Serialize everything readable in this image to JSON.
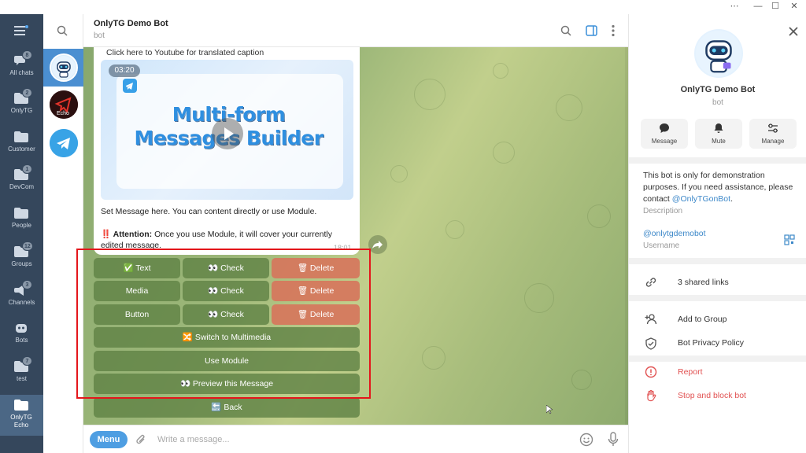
{
  "window": {
    "controls": [
      "⋯",
      "—",
      "☐",
      "✕"
    ]
  },
  "folders": [
    {
      "label": "All chats",
      "badge": "8",
      "icon": "chats-icon"
    },
    {
      "label": "OnlyTG",
      "badge": "2",
      "icon": "folder-icon"
    },
    {
      "label": "Customer",
      "badge": "",
      "icon": "folder-icon"
    },
    {
      "label": "DevCom",
      "badge": "1",
      "icon": "folder-icon"
    },
    {
      "label": "People",
      "badge": "",
      "icon": "folder-icon"
    },
    {
      "label": "Groups",
      "badge": "12",
      "icon": "groups-icon"
    },
    {
      "label": "Channels",
      "badge": "3",
      "icon": "channels-icon"
    },
    {
      "label": "Bots",
      "badge": "",
      "icon": "bots-icon"
    },
    {
      "label": "test",
      "badge": "7",
      "icon": "folder-icon"
    },
    {
      "label": "OnlyTG Echo",
      "badge": "",
      "icon": "folder-icon",
      "active": true
    }
  ],
  "chat": {
    "title": "OnlyTG Demo Bot",
    "subtitle": "bot",
    "caption_link": "Click here to Youtube for translated caption",
    "video": {
      "duration": "03:20",
      "title_line1": "Multi-form",
      "title_line2": "Messages Builder"
    },
    "body_line1": "Set Message here. You can content directly or use Module.",
    "attention_prefix": "‼️ ",
    "attention_label": "Attention:",
    "attention_text": " Once you use Module, it will cover your currently",
    "attention_line2": "edited message.",
    "time": "18:01"
  },
  "keyboard": {
    "rows": [
      [
        {
          "label": "✅ Text"
        },
        {
          "label": "👀 Check"
        },
        {
          "label": "🗑 Delete"
        }
      ],
      [
        {
          "label": "Media"
        },
        {
          "label": "👀 Check"
        },
        {
          "label": "🗑 Delete"
        }
      ],
      [
        {
          "label": "Button"
        },
        {
          "label": "👀 Check"
        },
        {
          "label": "🗑 Delete"
        }
      ]
    ],
    "switch": "🔀 Switch to Multimedia",
    "use_module": "Use Module",
    "preview": "👀 Preview this Message",
    "back": "🔙 Back"
  },
  "input": {
    "menu_label": "Menu",
    "placeholder": "Write a message..."
  },
  "profile": {
    "name": "OnlyTG Demo Bot",
    "subtitle": "bot",
    "actions": [
      "Message",
      "Mute",
      "Manage"
    ],
    "desc_before": "This bot is only for demonstration purposes. If you need assistance, please contact ",
    "desc_link": "@OnlyTGonBot",
    "desc_after": ".",
    "desc_label": "Description",
    "username": "@onlytgdemobot",
    "username_label": "Username",
    "shared_links": "3 shared links",
    "add_to_group": "Add to Group",
    "privacy": "Bot Privacy Policy",
    "report": "Report",
    "stop_block": "Stop and block bot"
  }
}
